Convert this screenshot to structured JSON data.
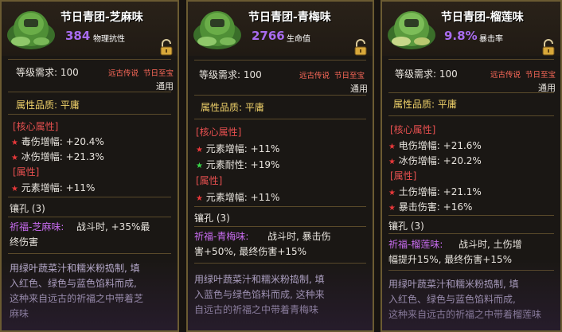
{
  "cards": [
    {
      "title": "节日青团-芝麻味",
      "main_value": "384",
      "main_label": "物理抗性",
      "main_color": "#a86cf0",
      "level_req": "等级需求: 100",
      "tag_left": "远古传说",
      "tag_right": "节日至宝",
      "tag_usage": "通用",
      "quality": "属性品质: 平庸",
      "core_header": "[核心属性]",
      "core_stats": [
        {
          "text": "毒伤增幅: +20.4%",
          "star_color": "#e8383a"
        },
        {
          "text": "冰伤增幅: +21.3%",
          "star_color": "#e8383a"
        }
      ],
      "attr_header": "[属性]",
      "attr_stats": [
        {
          "text": "元素增幅: +11%",
          "star_color": "#e8383a"
        }
      ],
      "socket": "镶孔 (3)",
      "blessing_name": "祈福-芝麻味:",
      "blessing_lines": [
        "战斗时, +35%最",
        "终伤害"
      ],
      "description": [
        "用绿叶蔬菜汁和糯米粉捣制, 填",
        "入红色、绿色与蓝色馅料而成,",
        "这种来自远古的祈福之中带着芝",
        "麻味"
      ]
    },
    {
      "title": "节日青团-青梅味",
      "main_value": "2766",
      "main_label": "生命值",
      "main_color": "#a86cf0",
      "level_req": "等级需求: 100",
      "tag_left": "远古传说",
      "tag_right": "节日至宝",
      "tag_usage": "通用",
      "quality": "属性品质: 平庸",
      "core_header": "[核心属性]",
      "core_stats": [
        {
          "text": "元素增幅: +11%",
          "star_color": "#e8383a"
        },
        {
          "text": "元素耐性: +19%",
          "star_color": "#3ad84a"
        }
      ],
      "attr_header": "[属性]",
      "attr_stats": [
        {
          "text": "元素增幅: +11%",
          "star_color": "#e8383a"
        }
      ],
      "socket": "镶孔 (3)",
      "blessing_name": "祈福-青梅味:",
      "blessing_lines": [
        "战斗时, 暴击伤",
        "害+50%, 最终伤害+15%"
      ],
      "description": [
        "用绿叶蔬菜汁和糯米粉捣制, 填",
        "入蓝色与绿色馅料而成, 这种来",
        "自远古的祈福之中带着青梅味"
      ]
    },
    {
      "title": "节日青团-榴莲味",
      "main_value": "9.8%",
      "main_label": "暴击率",
      "main_color": "#a86cf0",
      "level_req": "等级需求: 100",
      "tag_left": "远古传说",
      "tag_right": "节日至宝",
      "tag_usage": "通用",
      "quality": "属性品质: 平庸",
      "core_header": "[核心属性]",
      "core_stats": [
        {
          "text": "电伤增幅: +21.6%",
          "star_color": "#e8383a"
        },
        {
          "text": "冰伤增幅: +20.2%",
          "star_color": "#e8383a"
        }
      ],
      "attr_header": "[属性]",
      "attr_stats": [
        {
          "text": "土伤增幅: +21.1%",
          "star_color": "#e8383a"
        },
        {
          "text": "暴击伤害: +16%",
          "star_color": "#e8383a"
        }
      ],
      "socket": "镶孔 (3)",
      "blessing_name": "祈福-榴莲味:",
      "blessing_lines": [
        "战斗时, 土伤增",
        "幅提升15%, 最终伤害+15%"
      ],
      "description": [
        "用绿叶蔬菜汁和糯米粉捣制, 填",
        "入红色、绿色与蓝色馅料而成,",
        "这种来自远古的祈福之中带着榴莲味"
      ]
    }
  ]
}
